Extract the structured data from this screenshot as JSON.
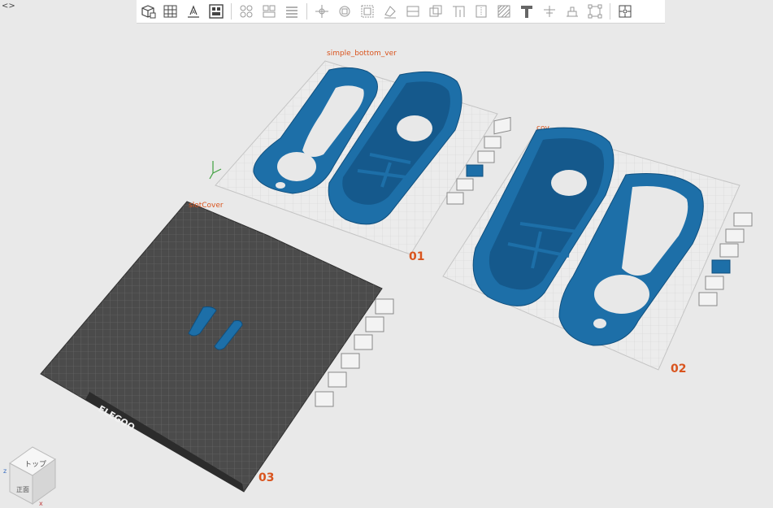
{
  "toolbar": {
    "items": [
      {
        "name": "add-object-icon",
        "group": 1
      },
      {
        "name": "add-plate-icon",
        "group": 1
      },
      {
        "name": "auto-orient-icon",
        "group": 1
      },
      {
        "name": "arrange-icon",
        "group": 1
      },
      {
        "name": "split-objects-icon",
        "group": 2
      },
      {
        "name": "split-parts-icon",
        "group": 2
      },
      {
        "name": "layers-icon",
        "group": 2
      },
      {
        "name": "move-icon",
        "group": 3
      },
      {
        "name": "rotate-icon",
        "group": 3
      },
      {
        "name": "scale-icon",
        "group": 3
      },
      {
        "name": "lay-on-face-icon",
        "group": 3
      },
      {
        "name": "cut-icon",
        "group": 3
      },
      {
        "name": "mesh-boolean-icon",
        "group": 3
      },
      {
        "name": "support-paint-icon",
        "group": 3
      },
      {
        "name": "seam-paint-icon",
        "group": 3
      },
      {
        "name": "color-paint-icon",
        "group": 3
      },
      {
        "name": "text-icon",
        "group": 3
      },
      {
        "name": "measure-icon",
        "group": 3
      },
      {
        "name": "emboss-icon",
        "group": 3
      },
      {
        "name": "assembly-icon",
        "group": 3
      },
      {
        "name": "puzzle-icon",
        "group": 4
      }
    ]
  },
  "corner_toggle": "<>",
  "plates": [
    {
      "label": "simple_bottom_ver",
      "number": "01"
    },
    {
      "label": "cov",
      "number": "02"
    },
    {
      "label": "slotCover",
      "number": "03"
    }
  ],
  "bed_brand": "ELEGOO",
  "view_cube": {
    "top": "トップ",
    "front": "正面",
    "axis_z": "z",
    "axis_x": "x"
  },
  "colors": {
    "model": "#1d6fa8",
    "accent": "#d9541e",
    "bed": "#4b4b4b"
  }
}
